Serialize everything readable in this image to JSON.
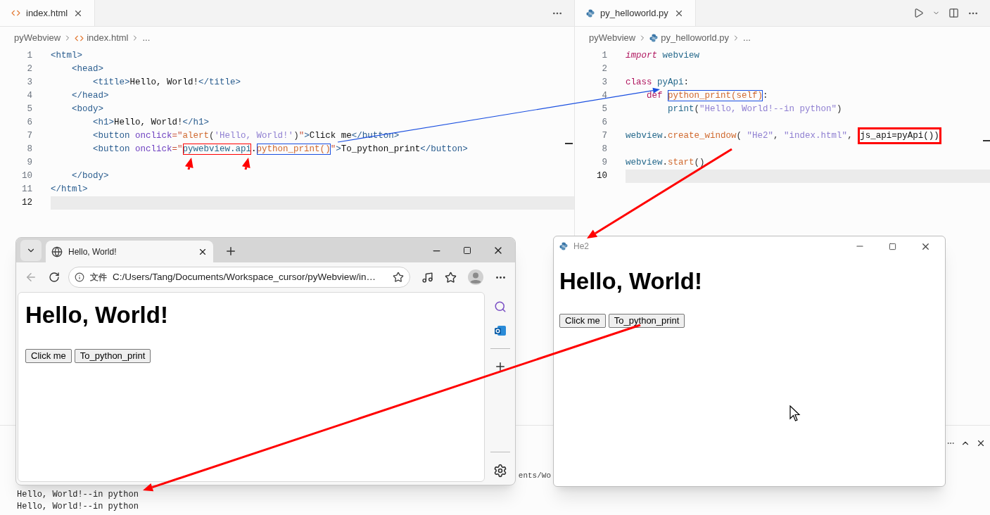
{
  "editors": [
    {
      "tab": {
        "label": "index.html"
      },
      "breadcrumb": [
        "pyWebview",
        "index.html",
        "..."
      ],
      "lines": [
        {
          "n": "1",
          "current": false,
          "tokens": [
            {
              "t": "<html>",
              "kind": "tag"
            }
          ]
        },
        {
          "n": "2",
          "current": false,
          "tokens": [
            {
              "t": "    <head>",
              "kind": "tag"
            }
          ]
        },
        {
          "n": "3",
          "current": false,
          "tokens": [
            {
              "t": "        <title>",
              "kind": "tag"
            },
            {
              "t": "Hello, World!",
              "kind": "text"
            },
            {
              "t": "</title>",
              "kind": "tag"
            }
          ]
        },
        {
          "n": "4",
          "current": false,
          "tokens": [
            {
              "t": "    </head>",
              "kind": "tag"
            }
          ]
        },
        {
          "n": "5",
          "current": false,
          "tokens": [
            {
              "t": "    <body>",
              "kind": "tag"
            }
          ]
        },
        {
          "n": "6",
          "current": false,
          "tokens": [
            {
              "t": "        <h1>",
              "kind": "tag"
            },
            {
              "t": "Hello, World!",
              "kind": "text"
            },
            {
              "t": "</h1>",
              "kind": "tag"
            }
          ]
        },
        {
          "n": "7",
          "current": false,
          "tokens": [
            {
              "t": "        <button ",
              "kind": "tag"
            },
            {
              "t": "onclick",
              "kind": "attr"
            },
            {
              "t": "=\"",
              "kind": "quote"
            },
            {
              "t": "alert",
              "kind": "func"
            },
            {
              "t": "(",
              "kind": "punct"
            },
            {
              "t": "'Hello, World!'",
              "kind": "string"
            },
            {
              "t": ")",
              "kind": "punct"
            },
            {
              "t": "\"",
              "kind": "quote"
            },
            {
              "t": ">",
              "kind": "tag"
            },
            {
              "t": "Click me",
              "kind": "text"
            },
            {
              "t": "</button>",
              "kind": "tag"
            }
          ]
        },
        {
          "n": "8",
          "current": false,
          "tokens": [
            {
              "t": "        <button ",
              "kind": "tag"
            },
            {
              "t": "onclick",
              "kind": "attr"
            },
            {
              "t": "=\"",
              "kind": "quote"
            },
            {
              "t": "pywebview.api",
              "kind": "ident",
              "box": {
                "color": "#ff0000",
                "thick": false
              }
            },
            {
              "t": ".",
              "kind": "text"
            },
            {
              "t": "python_print()",
              "kind": "func",
              "box": {
                "color": "#1a4fe0",
                "thick": false
              }
            },
            {
              "t": "\"",
              "kind": "quote"
            },
            {
              "t": ">",
              "kind": "tag"
            },
            {
              "t": "To_python_print",
              "kind": "text"
            },
            {
              "t": "</button>",
              "kind": "tag"
            }
          ]
        },
        {
          "n": "9",
          "current": false
        },
        {
          "n": "10",
          "current": false,
          "tokens": [
            {
              "t": "    </body>",
              "kind": "tag"
            }
          ]
        },
        {
          "n": "11",
          "current": false,
          "tokens": [
            {
              "t": "</html>",
              "kind": "tag"
            }
          ]
        },
        {
          "n": "12",
          "current": true
        }
      ]
    },
    {
      "tab": {
        "label": "py_helloworld.py"
      },
      "breadcrumb": [
        "pyWebview",
        "py_helloworld.py",
        "..."
      ],
      "lines": [
        {
          "n": "1",
          "current": false,
          "tokens": [
            {
              "t": "import",
              "kind": "italic-keyword"
            },
            {
              "t": " webview",
              "kind": "ident"
            }
          ]
        },
        {
          "n": "2",
          "current": false
        },
        {
          "n": "3",
          "current": false,
          "tokens": [
            {
              "t": "class",
              "kind": "keyword"
            },
            {
              "t": " pyApi",
              "kind": "ident"
            },
            {
              "t": ":",
              "kind": "punct"
            }
          ]
        },
        {
          "n": "4",
          "current": false,
          "tokens": [
            {
              "t": "    def ",
              "kind": "keyword"
            },
            {
              "t": "python_print(self)",
              "kind": "func",
              "box": {
                "color": "#1a4fe0",
                "thick": false
              }
            },
            {
              "t": ":",
              "kind": "punct"
            }
          ]
        },
        {
          "n": "5",
          "current": false,
          "tokens": [
            {
              "t": "        print",
              "kind": "ident"
            },
            {
              "t": "(",
              "kind": "punct"
            },
            {
              "t": "\"Hello, World!--in python\"",
              "kind": "string"
            },
            {
              "t": ")",
              "kind": "punct"
            }
          ]
        },
        {
          "n": "6",
          "current": false
        },
        {
          "n": "7",
          "current": false,
          "tokens": [
            {
              "t": "webview",
              "kind": "ident"
            },
            {
              "t": ".",
              "kind": "punct"
            },
            {
              "t": "create_window",
              "kind": "func"
            },
            {
              "t": "( ",
              "kind": "punct"
            },
            {
              "t": "\"He2\"",
              "kind": "string"
            },
            {
              "t": ", ",
              "kind": "punct"
            },
            {
              "t": "\"index.html\"",
              "kind": "string"
            },
            {
              "t": ", ",
              "kind": "punct"
            },
            {
              "t": "js_api=pyApi())",
              "kind": "text",
              "box": {
                "color": "#ff0000",
                "thick": true
              }
            }
          ]
        },
        {
          "n": "8",
          "current": false
        },
        {
          "n": "9",
          "current": false,
          "tokens": [
            {
              "t": "webview",
              "kind": "ident"
            },
            {
              "t": ".",
              "kind": "punct"
            },
            {
              "t": "start",
              "kind": "func"
            },
            {
              "t": "()",
              "kind": "punct"
            }
          ]
        },
        {
          "n": "10",
          "current": true
        }
      ]
    }
  ],
  "terminal": {
    "lines": [
      "Hello, World!--in python",
      "Hello, World!--in python"
    ],
    "fragment": "ents/Wo"
  },
  "browser": {
    "tab_title": "Hello, World!",
    "address_label": "文件",
    "url": "C:/Users/Tang/Documents/Workspace_cursor/pyWebview/in…",
    "heading": "Hello, World!",
    "buttons": [
      "Click me",
      "To_python_print"
    ]
  },
  "app_window": {
    "title": "He2",
    "heading": "Hello, World!",
    "buttons": [
      "Click me",
      "To_python_print"
    ]
  }
}
